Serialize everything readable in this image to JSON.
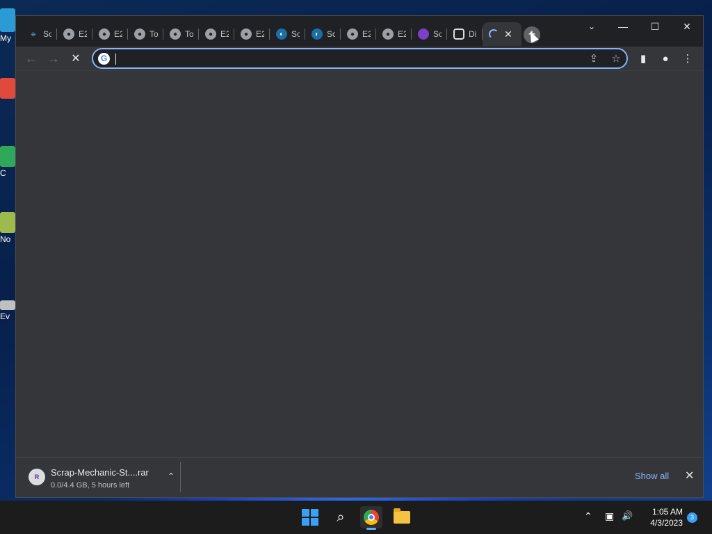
{
  "desktop": {
    "icons": [
      {
        "label": "My",
        "color": "#2b9bd6"
      },
      {
        "label": "",
        "color": "#e04a3a"
      },
      {
        "label": "C",
        "color": "#2fa85a"
      },
      {
        "label": "No",
        "color": "#9dbb4c"
      },
      {
        "label": "Ev",
        "color": "#c0c0c0"
      }
    ]
  },
  "browser": {
    "tabs": [
      {
        "title": "Sc",
        "icon": "gamepad-icon"
      },
      {
        "title": "E2",
        "icon": "globe-icon"
      },
      {
        "title": "E2",
        "icon": "globe-icon"
      },
      {
        "title": "To",
        "icon": "globe-icon"
      },
      {
        "title": "To",
        "icon": "globe-icon"
      },
      {
        "title": "E2",
        "icon": "globe-icon"
      },
      {
        "title": "E2",
        "icon": "globe-icon"
      },
      {
        "title": "Sc",
        "icon": "steam-icon"
      },
      {
        "title": "Sc",
        "icon": "steam-icon"
      },
      {
        "title": "E2",
        "icon": "globe-icon"
      },
      {
        "title": "E2",
        "icon": "globe-icon"
      },
      {
        "title": "Sc",
        "icon": "purple-logo-icon"
      },
      {
        "title": "Di",
        "icon": "database-icon"
      }
    ],
    "active_tab": {
      "close_glyph": "✕"
    },
    "new_tab_glyph": "+",
    "caption": {
      "tab_search": "⌄",
      "minimize": "—",
      "maximize": "☐",
      "close": "✕"
    },
    "toolbar": {
      "back": "←",
      "forward": "→",
      "stop": "✕",
      "address_value": "",
      "share": "⇪",
      "bookmark": "☆",
      "side_panel": "▮",
      "profile": "●",
      "menu": "⋮"
    },
    "download": {
      "file_name": "Scrap-Mechanic-St....rar",
      "status": "0.0/4.4 GB, 5 hours left",
      "icon_text": "R",
      "chevron": "⌃",
      "show_all": "Show all",
      "close": "✕"
    }
  },
  "taskbar": {
    "time": "1:05 AM",
    "date": "4/3/2023",
    "notification_count": "3",
    "tray_chevron": "⌃",
    "network": "▣",
    "volume": "🔊"
  },
  "colors": {
    "accent": "#8ab4f8",
    "window_bg": "#35363a",
    "titlebar_bg": "#202124",
    "taskbar_bg": "#1c1c1c"
  }
}
